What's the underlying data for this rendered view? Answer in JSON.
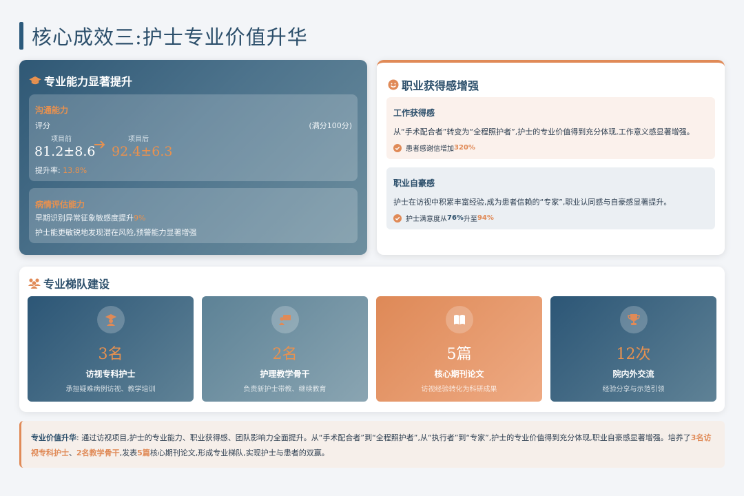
{
  "title": "核心成效三:护士专业价值升华",
  "ability": {
    "heading": "专业能力显著提升",
    "communication": {
      "label": "沟通能力",
      "score_label": "评分",
      "full_score": "(满分100分)",
      "before_label": "项目前",
      "after_label": "项目后",
      "before_value": "81.2±8.6",
      "after_value": "92.4±6.3",
      "rate_label": "提升率:",
      "rate_value": "13.8%"
    },
    "assessment": {
      "label": "病情评估能力",
      "line1_prefix": "早期识别异常征象敏感度提升",
      "line1_value": "9%",
      "line2": "护士能更敏锐地发现潜在风险,预警能力显著增强"
    }
  },
  "fulfillment": {
    "heading": "职业获得感增强",
    "work": {
      "title": "工作获得感",
      "text": "从“手术配合者”转变为“全程照护者”,护士的专业价值得到充分体现,工作意义感显著增强。",
      "stat_prefix": "患者感谢信增加",
      "stat_value": "320%"
    },
    "pride": {
      "title": "职业自豪感",
      "text": "护士在访视中积累丰富经验,成为患者信赖的“专家”,职业认同感与自豪感显著提升。",
      "stat_prefix": "护士满意度从",
      "stat_from": "76%",
      "stat_mid": "升至",
      "stat_to": "94%"
    }
  },
  "team": {
    "heading": "专业梯队建设",
    "tiles": [
      {
        "icon": "graduate-icon",
        "number": "3名",
        "title": "访视专科护士",
        "desc": "承担疑难病例访视、教学培训"
      },
      {
        "icon": "teacher-icon",
        "number": "2名",
        "title": "护理教学骨干",
        "desc": "负责新护士带教、继续教育"
      },
      {
        "icon": "book-icon",
        "number": "5篇",
        "title": "核心期刊论文",
        "desc": "访视经验转化为科研成果"
      },
      {
        "icon": "trophy-icon",
        "number": "12次",
        "title": "院内外交流",
        "desc": "经验分享与示范引领"
      }
    ]
  },
  "summary": {
    "label": "专业价值升华",
    "colon": ":",
    "text1": " 通过访视项目,护士的专业能力、职业获得感、团队影响力全面提升。从“手术配合者”到“全程照护者”,从“执行者”到“专家”,护士的专业价值得到充分体现,职业自豪感显著增强。培养了",
    "hl1": "3名访视专科护士",
    "sep": "、",
    "hl2": "2名教学骨干",
    "text2": ",发表",
    "hl3": "5篇",
    "text3": "核心期刊论文,形成专业梯队,实现护士与患者的双赢。"
  },
  "colors": {
    "navy": "#2c4f6b",
    "accent_orange": "#e08a57",
    "page_bg": "#f3f5f8"
  }
}
